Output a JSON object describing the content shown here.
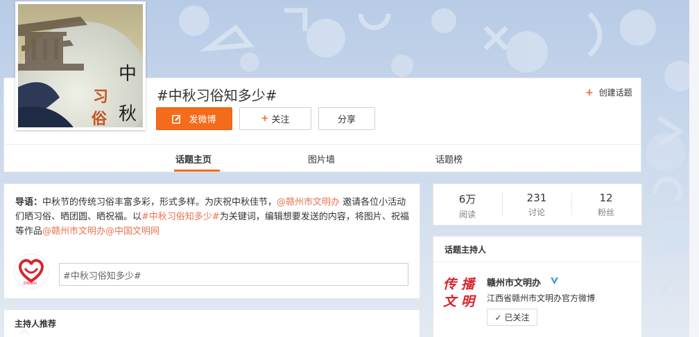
{
  "topic": {
    "cover_glyphs": [
      "中",
      "秋",
      "习",
      "俗"
    ],
    "title": "#中秋习俗知多少#",
    "post_button": "发微博",
    "follow_button": "关注",
    "share_button": "分享",
    "create_topic": "创建话题"
  },
  "tabs": [
    {
      "label": "话题主页"
    },
    {
      "label": "图片墙"
    },
    {
      "label": "话题榜"
    }
  ],
  "intro": {
    "lead": "导语：",
    "text1": "中秋节的传统习俗丰富多彩，形式多样。为庆祝中秋佳节，",
    "mention1": "@赣州市文明办",
    "text2": " 邀请各位小活动们晒习俗、晒团圆、晒祝福。以",
    "topic_link": "#中秋习俗知多少#",
    "text3": "为关键词，编辑想要发送的内容，将图片、祝福等作品",
    "mention2": "@赣州市文明办",
    "mention3": "@中国文明网",
    "input_value": "#中秋习俗知多少#",
    "avatar_caption": "文明赣州"
  },
  "host_recommend": {
    "title": "主持人推荐"
  },
  "stats": [
    {
      "value": "6万",
      "label": "阅读"
    },
    {
      "value": "231",
      "label": "讨论"
    },
    {
      "value": "12",
      "label": "粉丝"
    }
  ],
  "host": {
    "title": "话题主持人",
    "logo_glyphs": [
      "传",
      "播",
      "文",
      "明"
    ],
    "name": "赣州市文明办",
    "description": "江西省赣州市文明办官方微博",
    "followed": "已关注"
  },
  "colors": {
    "accent": "#f36b1b",
    "link": "#eb7350",
    "verified": "#3f9ae6",
    "logo_red": "#d9232d"
  }
}
